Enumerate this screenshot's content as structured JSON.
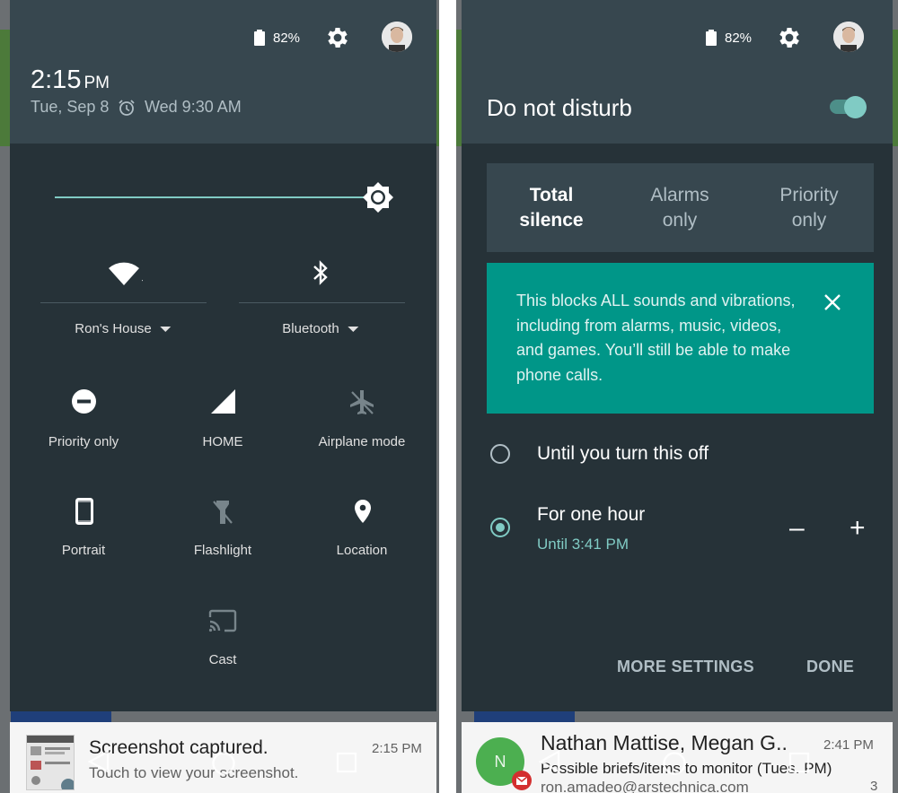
{
  "left": {
    "status": {
      "battery": "82%"
    },
    "clock": {
      "time": "2:15",
      "ampm": "PM"
    },
    "date": "Tue, Sep 8",
    "alarm": "Wed 9:30 AM",
    "tiles": {
      "wifi": "Ron's House",
      "bluetooth": "Bluetooth",
      "priority": "Priority only",
      "home": "HOME",
      "airplane": "Airplane mode",
      "portrait": "Portrait",
      "flashlight": "Flashlight",
      "location": "Location",
      "cast": "Cast"
    },
    "notification": {
      "title": "Screenshot captured.",
      "subtitle": "Touch to view your screenshot.",
      "time": "2:15 PM"
    }
  },
  "right": {
    "status": {
      "battery": "82%"
    },
    "title": "Do not disturb",
    "toggle_on": true,
    "segments": [
      {
        "line1": "Total",
        "line2": "silence"
      },
      {
        "line1": "Alarms",
        "line2": "only"
      },
      {
        "line1": "Priority",
        "line2": "only"
      }
    ],
    "info": "This blocks ALL sounds and vibrations, including from alarms, music, videos, and games. You’ll still be able to make phone calls.",
    "options": {
      "until_off": "Until you turn this off",
      "one_hour": "For one hour",
      "one_hour_sub": "Until 3:41 PM",
      "minus": "–",
      "plus": "+"
    },
    "actions": {
      "more": "MORE SETTINGS",
      "done": "DONE"
    },
    "notification": {
      "avatar_letter": "N",
      "title": "Nathan Mattise, Megan G..",
      "subtitle": "Possible briefs/items to monitor (Tues. PM)",
      "email": "ron.amadeo@arstechnica.com",
      "time": "2:41 PM",
      "count": "3"
    }
  },
  "colors": {
    "accent": "#80cbc4",
    "teal": "#009688",
    "shade": "#263238",
    "header": "#37474f"
  }
}
